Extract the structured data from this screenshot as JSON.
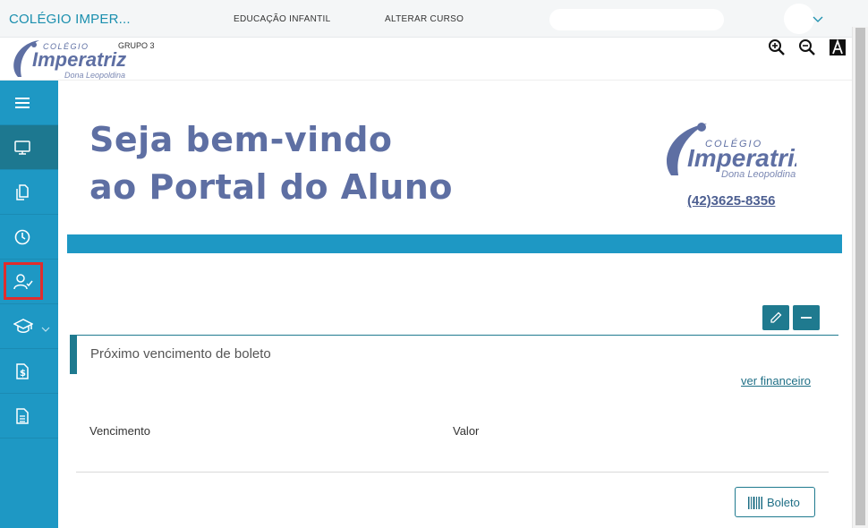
{
  "topbar": {
    "app_title": "COLÉGIO IMPER...",
    "nav_course": "EDUCAÇÃO INFANTIL",
    "nav_change": "ALTERAR CURSO"
  },
  "header": {
    "group_label": "GRUPO 3",
    "logo": {
      "top": "COLÉGIO",
      "name": "Imperatriz",
      "sub": "Dona Leopoldina"
    }
  },
  "sidebar": {
    "items": [
      {
        "icon": "menu-icon"
      },
      {
        "icon": "monitor-icon"
      },
      {
        "icon": "documents-icon"
      },
      {
        "icon": "clock-icon"
      },
      {
        "icon": "user-check-icon"
      },
      {
        "icon": "graduation-cap-icon"
      },
      {
        "icon": "dollar-file-icon"
      },
      {
        "icon": "document-lines-icon"
      }
    ]
  },
  "welcome": {
    "line1": "Seja bem-vindo",
    "line2": "ao Portal do Aluno",
    "phone": "(42)3625-8356"
  },
  "card": {
    "title": "Próximo vencimento de boleto",
    "link": "ver financeiro",
    "col_due": "Vencimento",
    "col_value": "Valor",
    "button_label": "Boleto"
  },
  "colors": {
    "sidebar": "#1e98c4",
    "sidebar_active": "#1d7890",
    "accent": "#1f7a8f",
    "welcome_text": "#5e6fa3",
    "highlight": "#e02d2d"
  }
}
